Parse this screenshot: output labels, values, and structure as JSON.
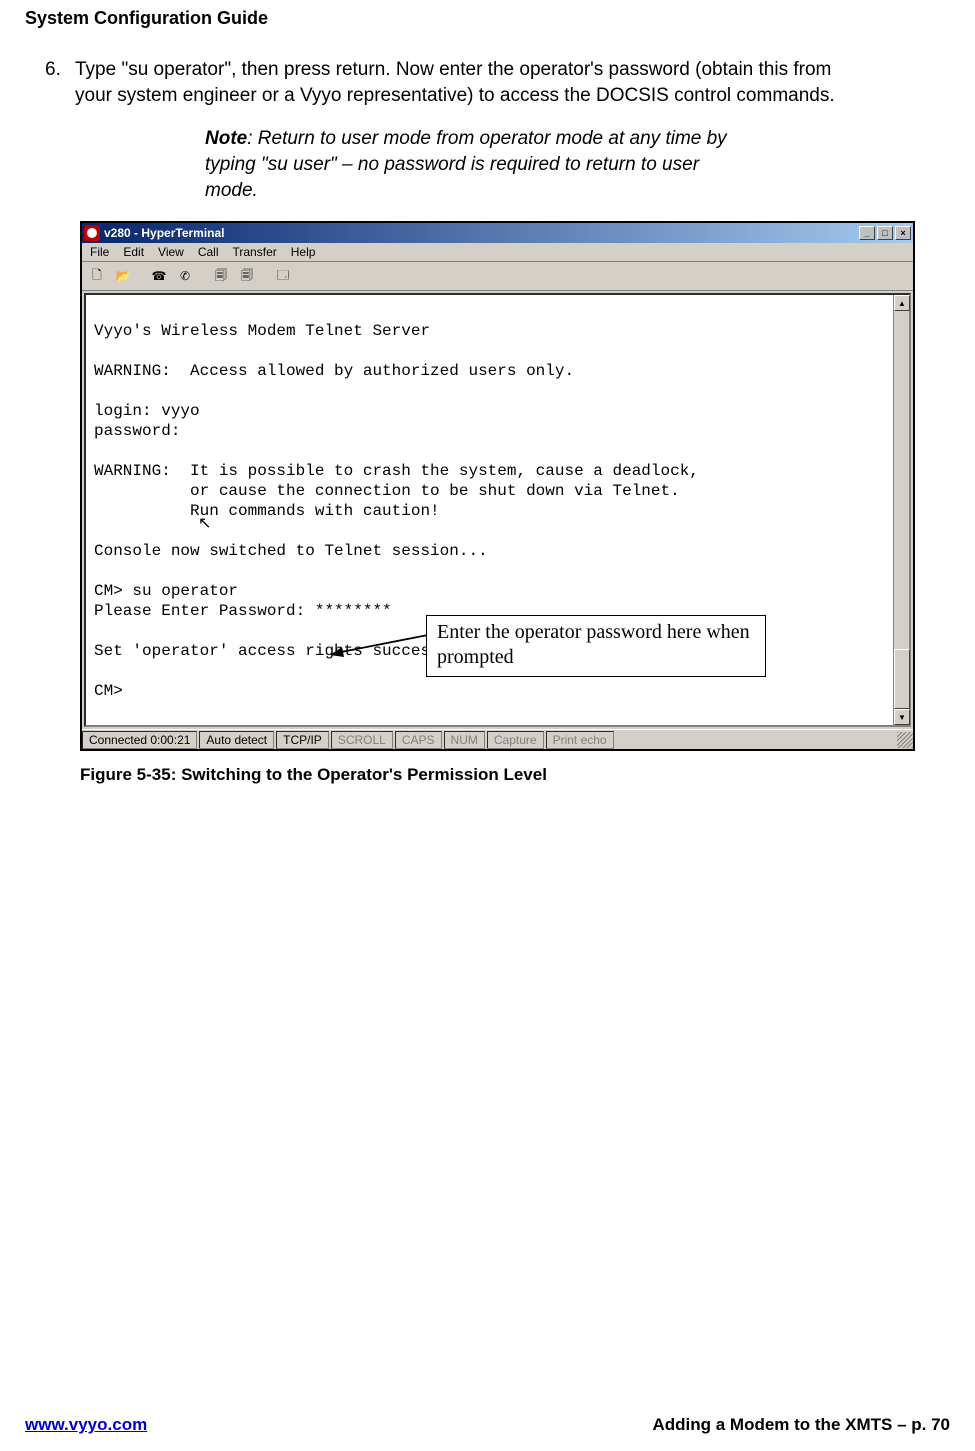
{
  "header": {
    "title": "System Configuration Guide"
  },
  "step": {
    "number": "6.",
    "text": "Type \"su operator\", then press return.  Now enter the operator's password (obtain this from your system engineer or a Vyyo representative) to access the DOCSIS control commands."
  },
  "note": {
    "label": "Note",
    "text": ": Return to user mode from operator mode at any time by typing \"su user\" – no password is required to return to user mode."
  },
  "ht": {
    "title": "v280 - HyperTerminal",
    "menus": [
      "File",
      "Edit",
      "View",
      "Call",
      "Transfer",
      "Help"
    ],
    "win_btns": {
      "min": "_",
      "max": "□",
      "close": "×"
    },
    "toolbar_icons": [
      "new-file-icon",
      "open-file-icon",
      "connect-icon",
      "disconnect-icon",
      "send-icon",
      "receive-icon",
      "properties-icon"
    ],
    "terminal_text": "Vyyo's Wireless Modem Telnet Server\n\nWARNING:  Access allowed by authorized users only.\n\nlogin: vyyo\npassword:\n\nWARNING:  It is possible to crash the system, cause a deadlock,\n          or cause the connection to be shut down via Telnet.\n          Run commands with caution!\n\nConsole now switched to Telnet session...\n\nCM> su operator\nPlease Enter Password: ********\n\nSet 'operator' access rights success.\n\nCM>",
    "status": {
      "connected": "Connected 0:00:21",
      "detect": "Auto detect",
      "proto": "TCP/IP",
      "scroll": "SCROLL",
      "caps": "CAPS",
      "num": "NUM",
      "capture": "Capture",
      "echo": "Print echo"
    }
  },
  "callout": {
    "text": "Enter the operator password here when prompted"
  },
  "caption": "Figure 5-35: Switching to the Operator's Permission Level",
  "footer": {
    "left": "www.vyyo.com",
    "right": "Adding a Modem to the XMTS – p. 70"
  }
}
